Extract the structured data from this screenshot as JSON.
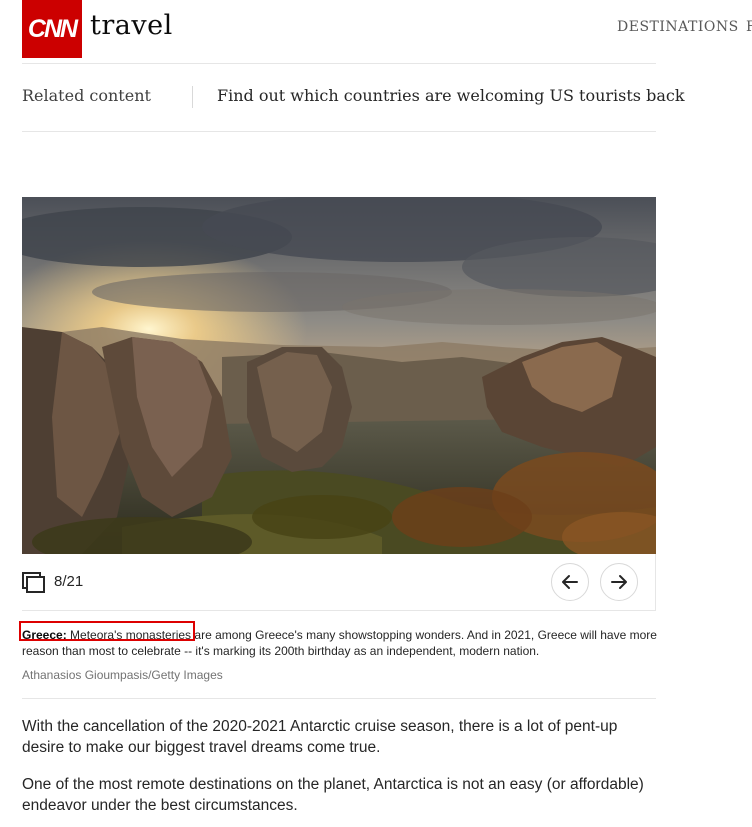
{
  "header": {
    "logo_cnn": "CNN",
    "logo_travel": "travel",
    "nav_destinations": "DESTINATIONS",
    "nav_more": "F"
  },
  "related": {
    "label": "Related content",
    "link": "Find out which countries are welcoming US tourists back"
  },
  "gallery": {
    "counter": "8/21",
    "image_alt": "Sunset over Meteora rock pillars in Greece"
  },
  "caption": {
    "country": "Greece:",
    "link": "Meteora's monasteries",
    "text_line": "are among Greece's many showstopping wonders. And in 2021, Greece will have more reason than most to celebrate -- it's marking its 200th birthday as an independent, modern nation.",
    "credit": "Athanasios Gioumpasis/Getty Images"
  },
  "body": {
    "para1": "With the cancellation of the 2020-2021 Antarctic cruise season, there is a lot of pent-up desire to make our biggest travel dreams come true.",
    "para2": "One of the most remote destinations on the planet, Antarctica is not an easy (or affordable) endeavor under the best circumstances."
  },
  "colors": {
    "brand": "#cc0000",
    "highlight": "#dd0000"
  }
}
